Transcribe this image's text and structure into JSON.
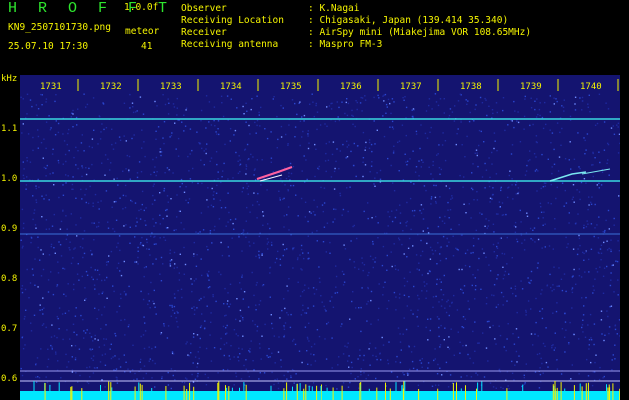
{
  "header": {
    "brand": "H R O F F T",
    "version": "1.0.0f",
    "filename": "KN9_2507101730.png",
    "category": "meteor",
    "timestamp": "25.07.10 17:30",
    "count": "41",
    "fields": [
      {
        "label": "Observer",
        "value": ": K.Nagai"
      },
      {
        "label": "Receiving Location",
        "value": ": Chigasaki, Japan (139.414 35.340)"
      },
      {
        "label": "Receiver",
        "value": ": AirSpy mini (Miakejima VOR 108.65MHz)"
      },
      {
        "label": "Receiving antenna",
        "value": ": Maspro FM-3"
      }
    ]
  },
  "spectrogram": {
    "y_unit": "kHz",
    "y_ticks": [
      "1.1",
      "1.0",
      "0.9",
      "0.8",
      "0.7",
      "0.6"
    ],
    "x_ticks": [
      "1731",
      "1732",
      "1733",
      "1734",
      "1735",
      "1736",
      "1737",
      "1738",
      "1739",
      "1740"
    ],
    "colors": {
      "background": "#141470",
      "trace": "#3ad8e0",
      "noise": "#2a46d0",
      "bar": "#00e8ff",
      "spikes": "#f5f500"
    }
  }
}
